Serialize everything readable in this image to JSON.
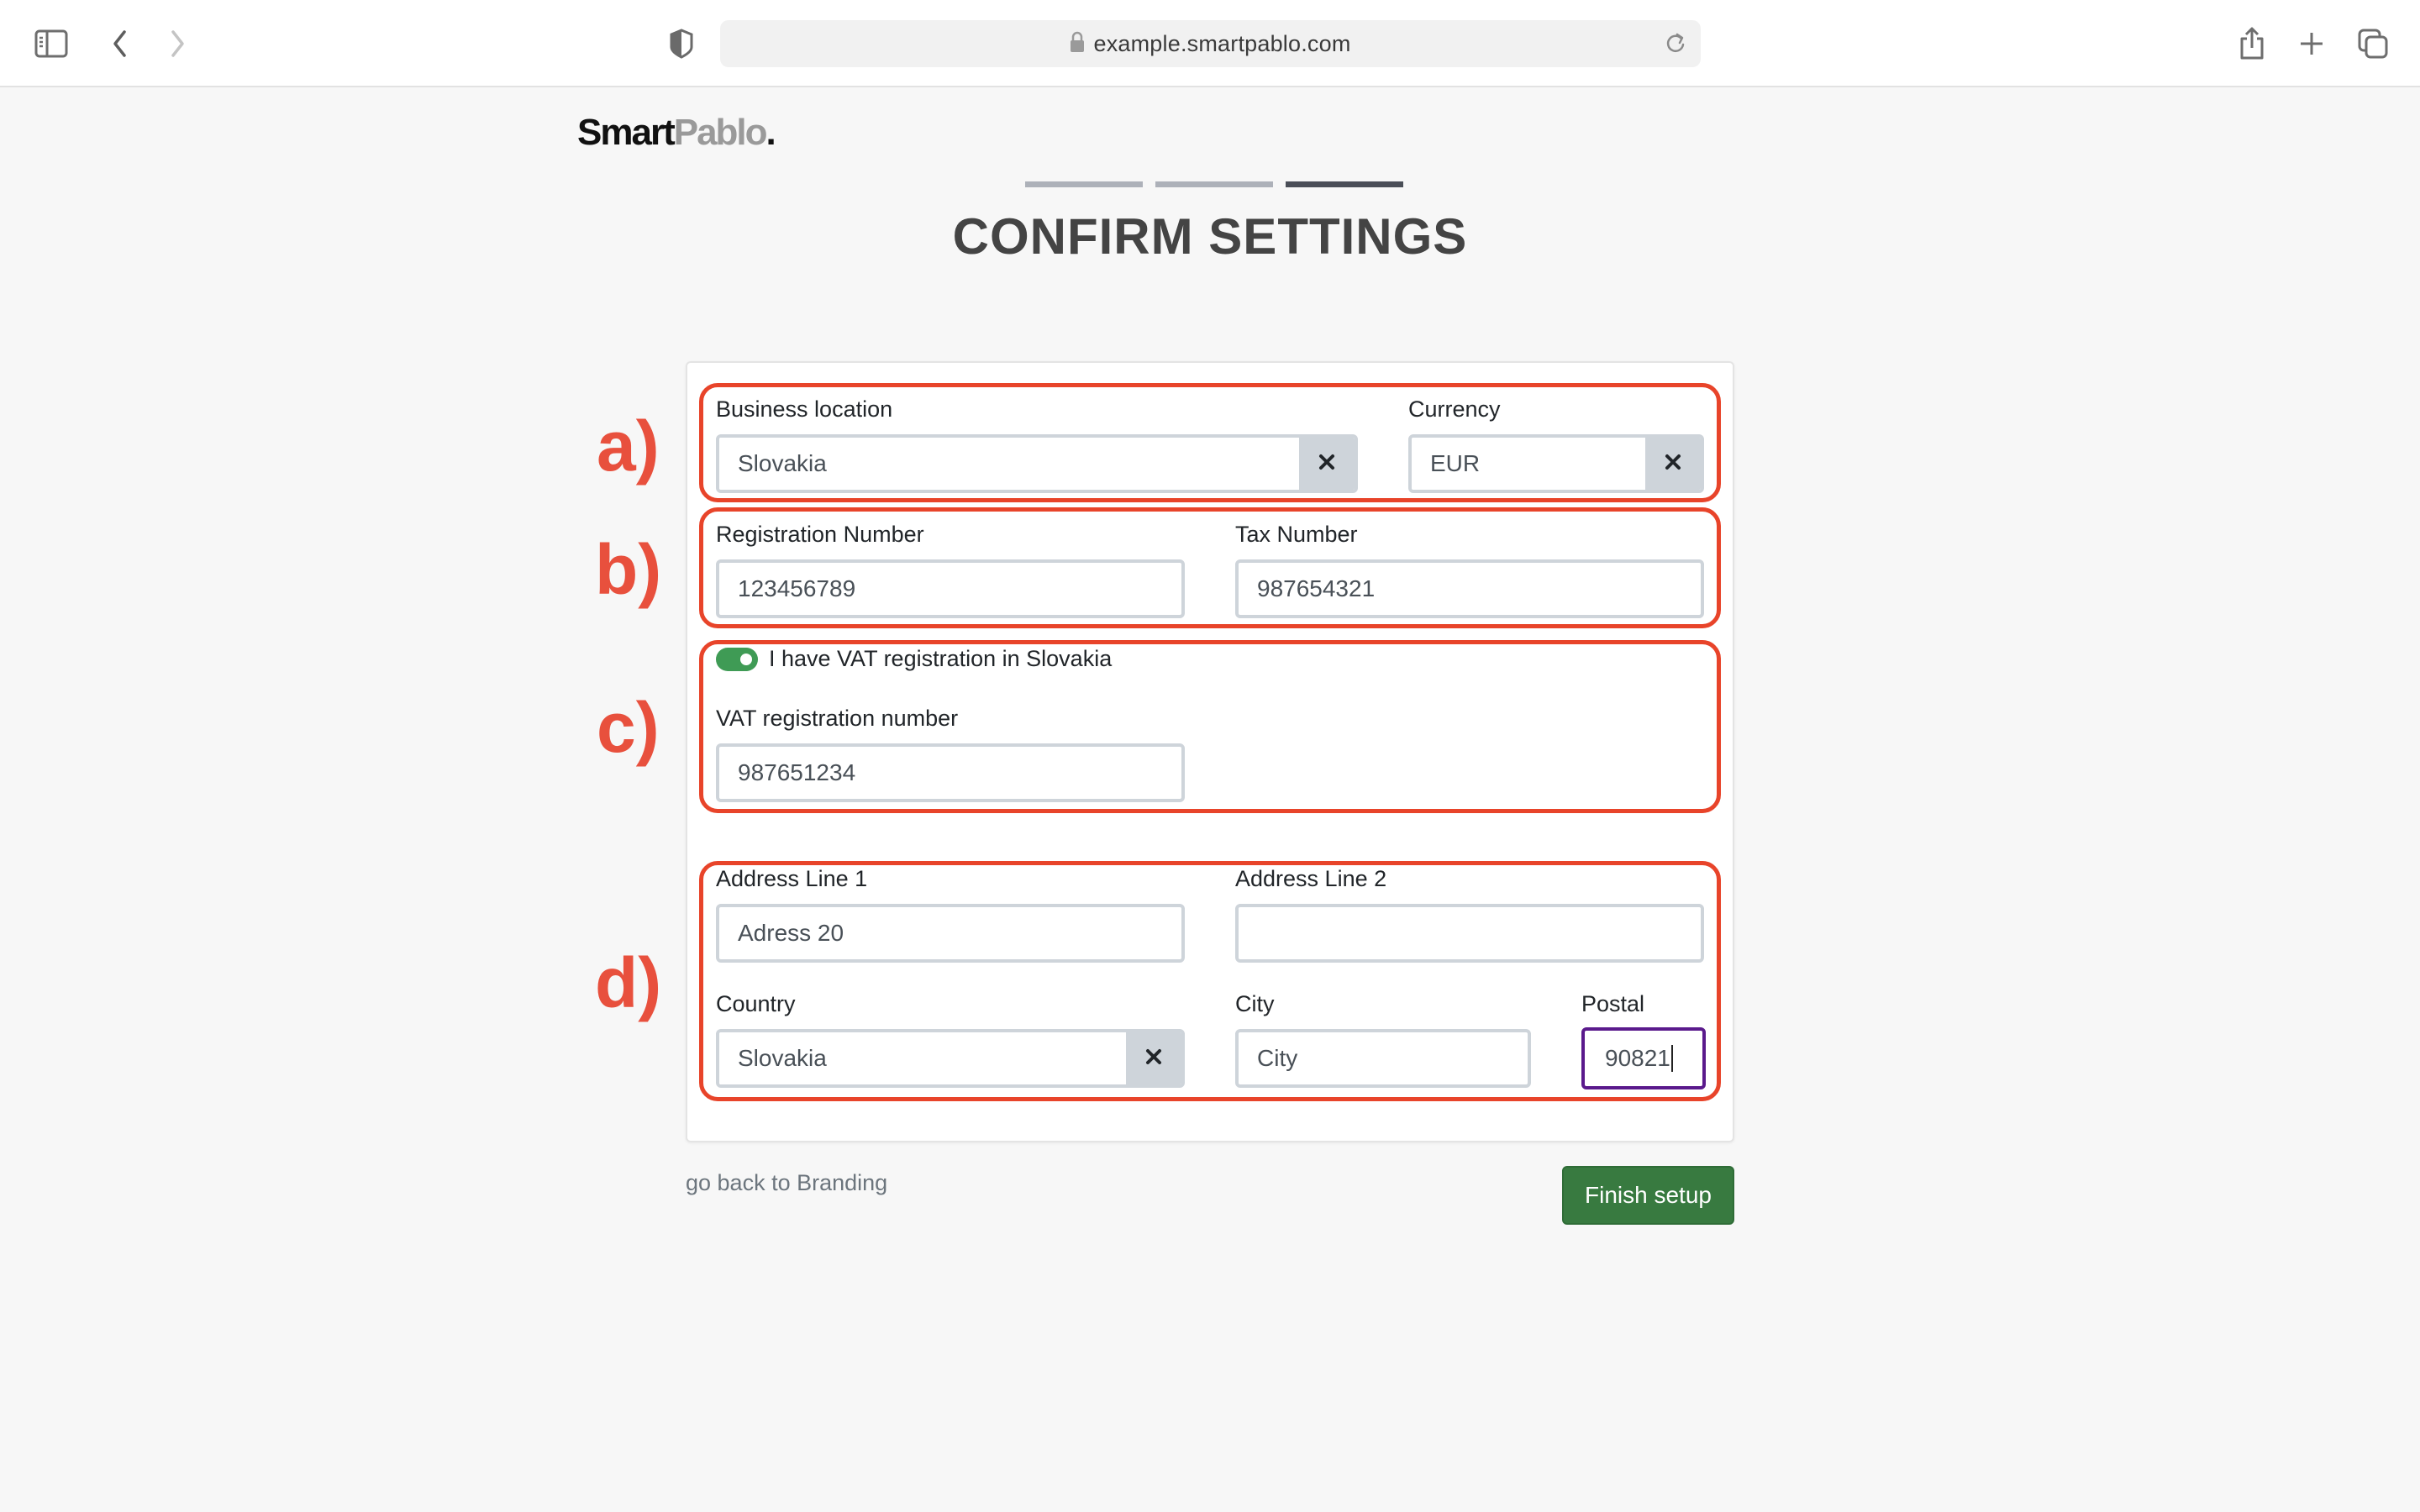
{
  "browser": {
    "url": "example.smartpablo.com",
    "icons": {
      "sidebar": "sidebar-toggle-icon",
      "back": "chevron-left-icon",
      "forward": "chevron-right-icon",
      "privacy": "shield-icon",
      "lock": "lock-icon",
      "reload": "reload-icon",
      "share": "share-icon",
      "new_tab": "plus-icon",
      "tabs": "tab-overview-icon"
    }
  },
  "logo": {
    "part1": "Smart",
    "part2": "Pablo",
    "dot": "."
  },
  "progress": {
    "total_steps": 3,
    "current_step": 3
  },
  "page": {
    "title": "CONFIRM SETTINGS"
  },
  "annotations": {
    "a": "a)",
    "b": "b)",
    "c": "c)",
    "d": "d)",
    "color": "#e8442a"
  },
  "form": {
    "business_location": {
      "label": "Business location",
      "value": "Slovakia"
    },
    "currency": {
      "label": "Currency",
      "value": "EUR"
    },
    "registration_number": {
      "label": "Registration Number",
      "value": "123456789"
    },
    "tax_number": {
      "label": "Tax Number",
      "value": "987654321"
    },
    "vat_toggle": {
      "label": "I have VAT registration in Slovakia",
      "checked": true
    },
    "vat_number": {
      "label": "VAT registration number",
      "value": "987651234"
    },
    "address_line_1": {
      "label": "Address Line 1",
      "value": "Adress 20"
    },
    "address_line_2": {
      "label": "Address Line 2",
      "value": ""
    },
    "country": {
      "label": "Country",
      "value": "Slovakia"
    },
    "city": {
      "label": "City",
      "value": "City"
    },
    "postal": {
      "label": "Postal",
      "value": "90821"
    }
  },
  "footer": {
    "back_link": "go back to Branding",
    "finish_button": "Finish setup"
  },
  "colors": {
    "accent_green": "#387a40",
    "toggle_green": "#3f9b55",
    "focus_purple": "#5a1a8c",
    "annotation_red": "#e8442a"
  }
}
